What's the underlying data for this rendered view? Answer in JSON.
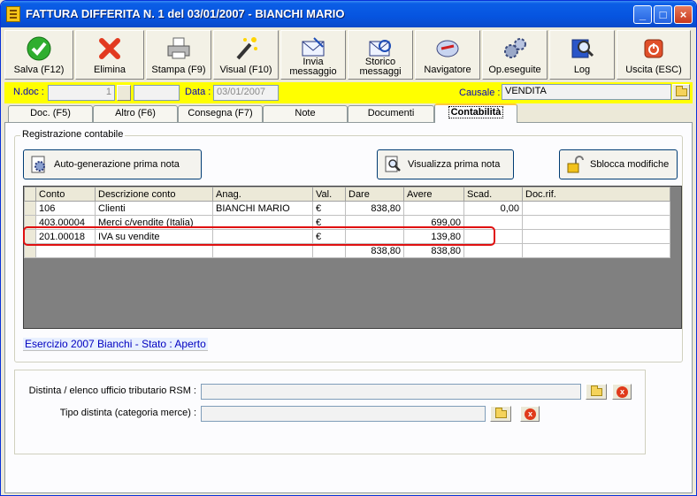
{
  "window": {
    "title": "FATTURA DIFFERITA N. 1  del 03/01/2007 - BIANCHI MARIO",
    "minimize": "_",
    "maximize": "□",
    "close": "×"
  },
  "toolbar": {
    "save": "Salva (F12)",
    "delete": "Elimina",
    "print": "Stampa (F9)",
    "visual": "Visual (F10)",
    "send_1": "Invia",
    "send_2": "messaggio",
    "history_1": "Storico",
    "history_2": "messaggi",
    "navigator": "Navigatore",
    "operations": "Op.eseguite",
    "log": "Log",
    "exit": "Uscita (ESC)"
  },
  "docbar": {
    "ndoc_label": "N.doc :",
    "ndoc_value": "1",
    "data_label": "Data :",
    "data_value": "03/01/2007",
    "causale_label": "Causale :",
    "causale_value": "VENDITA"
  },
  "tabs": [
    "Doc. (F5)",
    "Altro (F6)",
    "Consegna (F7)",
    "Note",
    "Documenti",
    "Contabilità"
  ],
  "registrazione": {
    "group_title": "Registrazione contabile",
    "auto_button": "Auto-generazione prima nota",
    "view_button": "Visualizza prima nota",
    "unlock_button": "Sblocca modifiche"
  },
  "grid": {
    "headers": [
      "Conto",
      "Descrizione conto",
      "Anag.",
      "Val.",
      "Dare",
      "Avere",
      "Scad.",
      "Doc.rif."
    ],
    "rows": [
      [
        "106",
        "Clienti",
        "BIANCHI MARIO",
        "€",
        "838,80",
        "",
        "0,00",
        ""
      ],
      [
        "403.00004",
        "Merci c/vendite (Italia)",
        "",
        "€",
        "",
        "699,00",
        "",
        ""
      ],
      [
        "201.00018",
        "IVA su vendite",
        "",
        "€",
        "",
        "139,80",
        "",
        ""
      ],
      [
        "",
        "",
        "",
        "",
        "838,80",
        "838,80",
        "",
        ""
      ]
    ]
  },
  "status": {
    "esercizio": "Esercizio 2007 Bianchi - Stato : Aperto"
  },
  "lower": {
    "distinta_label": "Distinta / elenco ufficio tributario RSM :",
    "tipo_label": "Tipo distinta (categoria merce) :"
  },
  "colors": {
    "title_bar": "#0654e0",
    "doc_bar": "#ffff00",
    "highlight": "#e01010",
    "status_text": "#0000c0"
  },
  "icons": [
    "check-icon",
    "x-icon",
    "printer-icon",
    "magic-wand-icon",
    "envelope-icon",
    "history-icon",
    "compass-icon",
    "gears-icon",
    "magnifier-book-icon",
    "power-icon",
    "gear-doc-icon",
    "magnifier-doc-icon",
    "padlock-icon",
    "folder-icon",
    "delete-icon"
  ]
}
